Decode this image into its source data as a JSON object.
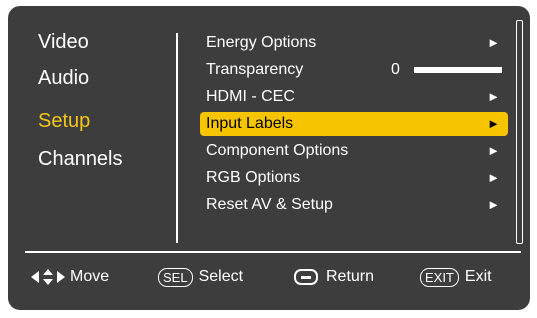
{
  "categories": [
    "Video",
    "Audio",
    "Setup",
    "Channels"
  ],
  "active_category": "Setup",
  "menu": {
    "items": [
      {
        "label": "Energy Options",
        "arrow": "►"
      },
      {
        "label": "Transparency",
        "value": "0",
        "level": 0
      },
      {
        "label": "HDMI - CEC",
        "arrow": "►"
      },
      {
        "label": "Input Labels",
        "arrow": "►"
      },
      {
        "label": "Component Options",
        "arrow": "►"
      },
      {
        "label": "RGB Options",
        "arrow": "►"
      },
      {
        "label": "Reset AV & Setup",
        "arrow": "►"
      }
    ],
    "selected": "Input Labels"
  },
  "footer": {
    "move_label": "Move",
    "sel_key": "SEL",
    "select_label": "Select",
    "return_label": "Return",
    "exit_key": "EXIT",
    "exit_label": "Exit"
  },
  "colors": {
    "background": "#3d3d3d",
    "highlight": "#f7c500",
    "active_text": "#f5c518"
  }
}
